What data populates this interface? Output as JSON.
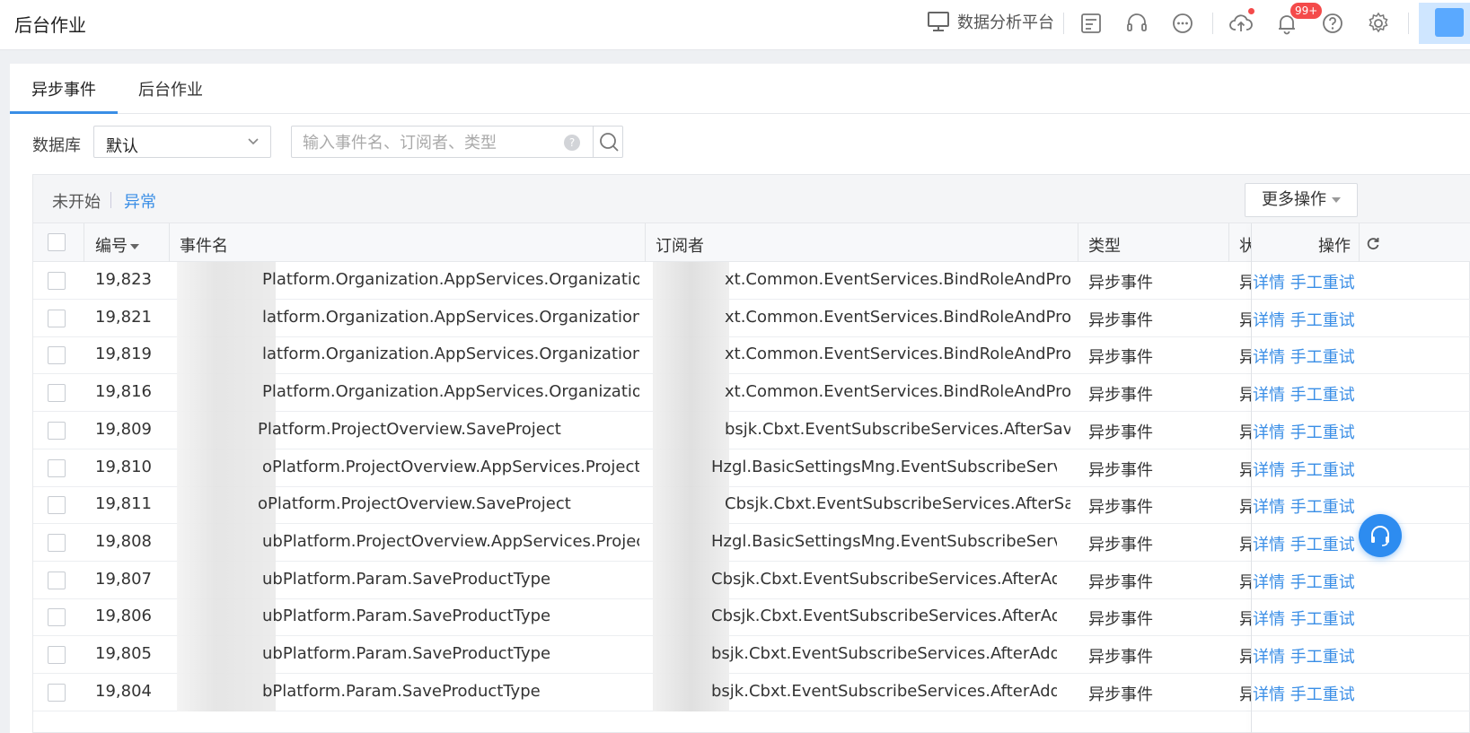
{
  "header": {
    "title": "后台作业",
    "platform_label": "数据分析平台",
    "notification_badge": "99+"
  },
  "tabs": [
    {
      "label": "异步事件",
      "active": true
    },
    {
      "label": "后台作业",
      "active": false
    }
  ],
  "filters": {
    "db_label": "数据库",
    "db_value": "默认",
    "search_placeholder": "输入事件名、订阅者、类型"
  },
  "toolbar": {
    "status_filters": [
      "未开始",
      "异常"
    ],
    "active_filter": "异常",
    "more_actions": "更多操作"
  },
  "table": {
    "columns": {
      "id": "编号",
      "event": "事件名",
      "subscriber": "订阅者",
      "type": "类型",
      "status": "状",
      "actions": "操作"
    },
    "action_labels": {
      "detail": "详情",
      "retry": "手工重试"
    },
    "rows": [
      {
        "id": "19,823",
        "event": "Platform.Organization.AppServices.OrganizationA...",
        "subscriber": "xt.Common.EventServices.BindRoleAndProjec...",
        "type": "异步事件",
        "status": "异"
      },
      {
        "id": "19,821",
        "event": "latform.Organization.AppServices.OrganizationA...",
        "subscriber": "xt.Common.EventServices.BindRoleAndProjec...",
        "type": "异步事件",
        "status": "异"
      },
      {
        "id": "19,819",
        "event": "latform.Organization.AppServices.OrganizationA...",
        "subscriber": "xt.Common.EventServices.BindRoleAndProjec...",
        "type": "异步事件",
        "status": "异"
      },
      {
        "id": "19,816",
        "event": "Platform.Organization.AppServices.OrganizationA...",
        "subscriber": "xt.Common.EventServices.BindRoleAndProjec...",
        "type": "异步事件",
        "status": "异"
      },
      {
        "id": "19,809",
        "event": "Platform.ProjectOverview.SaveProject",
        "subscriber": "bsjk.Cbxt.EventSubscribeServices.AfterSavePro...",
        "type": "异步事件",
        "status": "异"
      },
      {
        "id": "19,810",
        "event": "oPlatform.ProjectOverview.AppServices.ProjectOve...",
        "subscriber": "Hzgl.BasicSettingsMng.EventSubscribeServices....",
        "type": "异步事件",
        "status": "异"
      },
      {
        "id": "19,811",
        "event": "oPlatform.ProjectOverview.SaveProject",
        "subscriber": "Cbsjk.Cbxt.EventSubscribeServices.AfterSavePro...",
        "type": "异步事件",
        "status": "异"
      },
      {
        "id": "19,808",
        "event": "ubPlatform.ProjectOverview.AppServices.ProjectOve...",
        "subscriber": "Hzgl.BasicSettingsMng.EventSubscribeServices....",
        "type": "异步事件",
        "status": "异"
      },
      {
        "id": "19,807",
        "event": "ubPlatform.Param.SaveProductType",
        "subscriber": "Cbsjk.Cbxt.EventSubscribeServices.AfterAddPro...",
        "type": "异步事件",
        "status": "异"
      },
      {
        "id": "19,806",
        "event": "ubPlatform.Param.SaveProductType",
        "subscriber": "Cbsjk.Cbxt.EventSubscribeServices.AfterAddPro...",
        "type": "异步事件",
        "status": "异"
      },
      {
        "id": "19,805",
        "event": "ubPlatform.Param.SaveProductType",
        "subscriber": "bsjk.Cbxt.EventSubscribeServices.AfterAddPro...",
        "type": "异步事件",
        "status": "异"
      },
      {
        "id": "19,804",
        "event": "bPlatform.Param.SaveProductType",
        "subscriber": "bsjk.Cbxt.EventSubscribeServices.AfterAddPro...",
        "type": "异步事件",
        "status": "异"
      }
    ]
  },
  "colors": {
    "accent": "#3a8ee6",
    "badge": "#f44a4a"
  }
}
